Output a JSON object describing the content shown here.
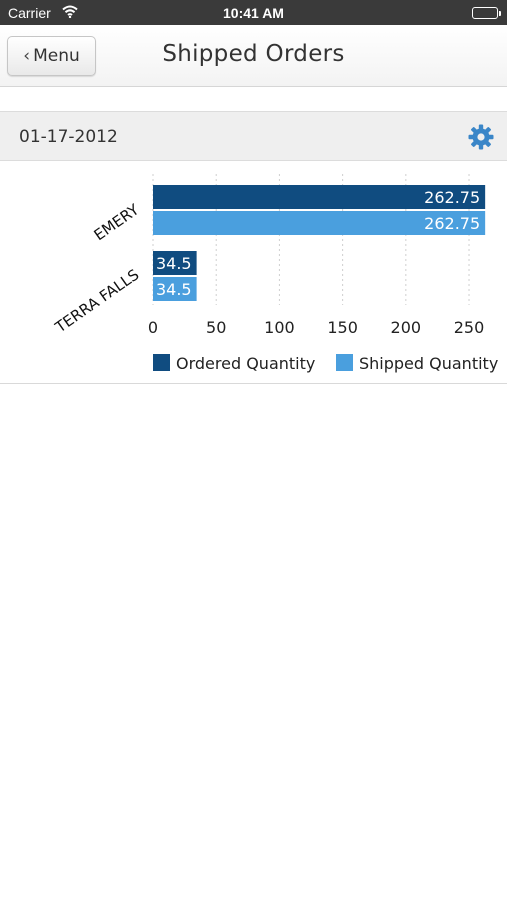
{
  "status_bar": {
    "carrier": "Carrier",
    "time": "10:41 AM"
  },
  "nav": {
    "back_label": "Menu",
    "title": "Shipped Orders"
  },
  "date_bar": {
    "date": "01-17-2012"
  },
  "colors": {
    "ordered": "#104c80",
    "shipped": "#4a9fde",
    "accent": "#3a86c8"
  },
  "chart_data": {
    "type": "bar",
    "orientation": "horizontal",
    "categories": [
      "EMERY",
      "TERRA FALLS"
    ],
    "series": [
      {
        "name": "Ordered Quantity",
        "values": [
          262.75,
          34.5
        ]
      },
      {
        "name": "Shipped Quantity",
        "values": [
          262.75,
          34.5
        ]
      }
    ],
    "xlim": [
      0,
      265
    ],
    "x_ticks": [
      0,
      50,
      100,
      150,
      200,
      250
    ],
    "data_labels": [
      "262.75",
      "262.75",
      "34.5",
      "34.5"
    ],
    "grid": true,
    "legend": "bottom"
  }
}
